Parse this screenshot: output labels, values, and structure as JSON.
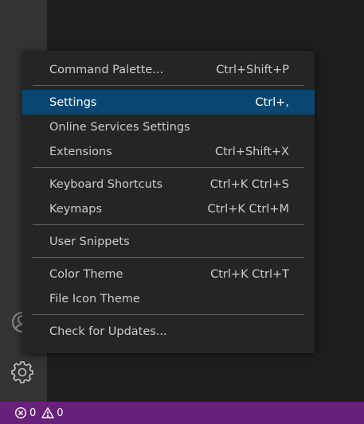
{
  "menu": {
    "groups": [
      [
        {
          "label": "Command Palette...",
          "keybinding": "Ctrl+Shift+P"
        }
      ],
      [
        {
          "label": "Settings",
          "keybinding": "Ctrl+,",
          "active": true
        },
        {
          "label": "Online Services Settings",
          "keybinding": ""
        },
        {
          "label": "Extensions",
          "keybinding": "Ctrl+Shift+X"
        }
      ],
      [
        {
          "label": "Keyboard Shortcuts",
          "keybinding": "Ctrl+K Ctrl+S"
        },
        {
          "label": "Keymaps",
          "keybinding": "Ctrl+K Ctrl+M"
        }
      ],
      [
        {
          "label": "User Snippets",
          "keybinding": ""
        }
      ],
      [
        {
          "label": "Color Theme",
          "keybinding": "Ctrl+K Ctrl+T"
        },
        {
          "label": "File Icon Theme",
          "keybinding": ""
        }
      ],
      [
        {
          "label": "Check for Updates...",
          "keybinding": ""
        }
      ]
    ]
  },
  "activity_bar": {
    "icons": [
      "accounts-icon",
      "gear-icon"
    ]
  },
  "status_bar": {
    "errors": "0",
    "warnings": "0",
    "error_icon": "error-circle-icon",
    "warning_icon": "warning-triangle-icon"
  },
  "colors": {
    "status_bar_bg": "#68217a",
    "menu_active_bg": "#094771",
    "menu_bg": "#252526"
  }
}
